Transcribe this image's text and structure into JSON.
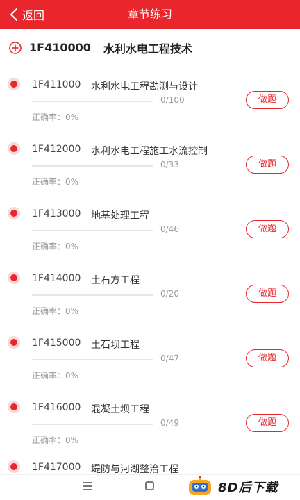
{
  "header": {
    "back_label": "返回",
    "title": "章节练习",
    "bg_color": "#e8262c"
  },
  "section": {
    "icon": "plus-circle-icon",
    "code": "1F410000",
    "name": "水利水电工程技术"
  },
  "chapters": [
    {
      "code": "1F411000",
      "name": "水利水电工程勘测与设计",
      "progress_text": "0/100",
      "progress": 0,
      "accuracy_text": "正确率：0%",
      "button_label": "做题"
    },
    {
      "code": "1F412000",
      "name": "水利水电工程施工水流控制",
      "progress_text": "0/33",
      "progress": 0,
      "accuracy_text": "正确率：0%",
      "button_label": "做题"
    },
    {
      "code": "1F413000",
      "name": "地基处理工程",
      "progress_text": "0/46",
      "progress": 0,
      "accuracy_text": "正确率：0%",
      "button_label": "做题"
    },
    {
      "code": "1F414000",
      "name": "土石方工程",
      "progress_text": "0/20",
      "progress": 0,
      "accuracy_text": "正确率：0%",
      "button_label": "做题"
    },
    {
      "code": "1F415000",
      "name": "土石坝工程",
      "progress_text": "0/47",
      "progress": 0,
      "accuracy_text": "正确率：0%",
      "button_label": "做题"
    },
    {
      "code": "1F416000",
      "name": "混凝土坝工程",
      "progress_text": "0/49",
      "progress": 0,
      "accuracy_text": "正确率：0%",
      "button_label": "做题"
    },
    {
      "code": "1F417000",
      "name": "堤防与河湖整治工程",
      "progress_text": "",
      "progress": 0,
      "accuracy_text": "",
      "button_label": ""
    }
  ],
  "navbar": {
    "menu_icon": "menu-icon",
    "home_icon": "home-square-icon"
  },
  "watermark": {
    "text": "8D后下载",
    "icon": "robot-logo-icon"
  }
}
